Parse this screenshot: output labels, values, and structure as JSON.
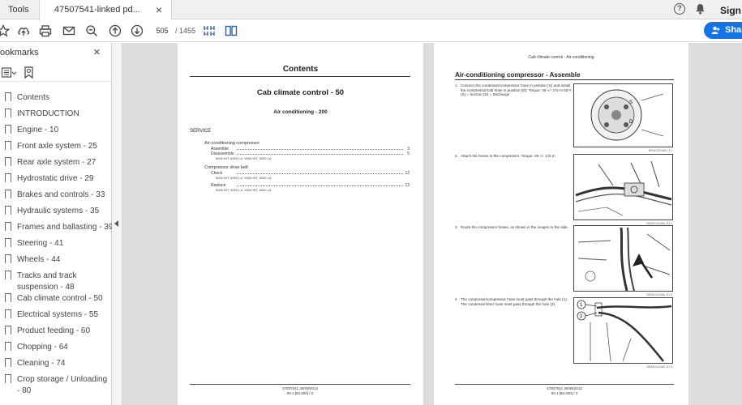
{
  "tabs": {
    "tools_label": "Tools",
    "doc_tab_label": "47507541-linked pd...",
    "close_glyph": "×"
  },
  "account": {
    "sign_in_label": "Sign I"
  },
  "toolbar": {
    "page_current": "505",
    "page_total": "/ 1455",
    "share_label": "Share"
  },
  "sidebar": {
    "title": "ookmarks",
    "close_glyph": "×",
    "items": [
      {
        "label": "Contents"
      },
      {
        "label": "INTRODUCTION"
      },
      {
        "label": "Engine - 10"
      },
      {
        "label": "Front axle system - 25"
      },
      {
        "label": "Rear axle system - 27"
      },
      {
        "label": "Hydrostatic drive - 29"
      },
      {
        "label": "Brakes and controls - 33"
      },
      {
        "label": "Hydraulic systems - 35"
      },
      {
        "label": "Frames and ballasting - 39"
      },
      {
        "label": "Steering - 41"
      },
      {
        "label": "Wheels - 44"
      },
      {
        "label": "Tracks and track suspension - 48"
      },
      {
        "label": "Cab climate control - 50"
      },
      {
        "label": "Electrical systems - 55"
      },
      {
        "label": "Product feeding - 60"
      },
      {
        "label": "Chopping - 64"
      },
      {
        "label": "Cleaning - 74"
      },
      {
        "label": "Crop storage / Unloading - 80"
      }
    ]
  },
  "page_left": {
    "title": "Contents",
    "section": "Cab climate control - 50",
    "subsection": "Air conditioning - 200",
    "service": "SERVICE",
    "group1": {
      "heading": "Air-conditioning compressor",
      "line1": "Assemble",
      "line1_page": "3",
      "line2": "Disassemble",
      "line2_page": "5",
      "line2_models": "5000 INT, 6000 LA, 5000 INT, 6000 LA"
    },
    "group2": {
      "heading": "Compressor drive belt",
      "line1": "Check",
      "line1_page": "12",
      "line1_models": "5000 INT, 6000 LA, 5000 INT, 6000 LA",
      "line2": "Replace",
      "line2_page": "13",
      "line2_models": "5000 INT, 6000 LA, 5000 INT, 6000 LA"
    },
    "footer_line1": "47507541 26/09/2013",
    "footer_line2": "50.1 [50.200] / 2"
  },
  "page_right": {
    "header": "Cab climate control - Air conditioning",
    "title": "Air-conditioning compressor - Assemble",
    "steps": [
      {
        "n": "1.",
        "text": "Connect the condenser/compressor hose in position (S) and install the compressor/cab hose in position (D). Torque: 48 +/- 3 N·m KEY: (S) = Suction (D) = Discharge",
        "caption": "BRAE10CAM1,3 1"
      },
      {
        "n": "2.",
        "text": "Attach the hoses to the compressor. Torque: 48 +/- 3 N·m",
        "caption": "BRAE10CAML,D1 2"
      },
      {
        "n": "3.",
        "text": "Route the compressor hoses, as shown in the images to the side.",
        "caption": "BRAE10CAML,D1 3"
      },
      {
        "n": "4.",
        "text": "The condenser/compressor hose must pass through the hole (1). The condenser/drier hose must pass through the hole (2).",
        "caption": "BRAE10CAML,D1 4"
      }
    ],
    "footer_line1": "47507541 26/09/2013",
    "footer_line2": "50.1 [50.200] / 3"
  }
}
